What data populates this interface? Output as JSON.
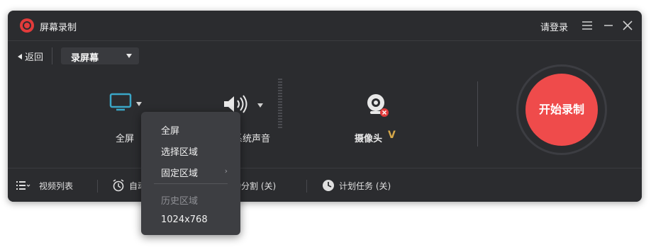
{
  "app": {
    "title": "屏幕录制",
    "login_label": "请登录"
  },
  "toolbar": {
    "back_label": "返回",
    "mode_label": "录屏幕"
  },
  "sources": {
    "screen_label": "全屏",
    "audio_label": "系统声音",
    "camera_label": "摄像头",
    "vip_badge": "V"
  },
  "record_button": {
    "label": "开始录制"
  },
  "bottom": {
    "video_list": "视频列表",
    "auto_stop": "自动停止 (关)",
    "auto_split": "自动分割 (关)",
    "schedule": "计划任务 (关)"
  },
  "dropdown_menu": {
    "items": [
      "全屏",
      "选择区域",
      "固定区域"
    ],
    "chevron": "›",
    "history_header": "历史区域",
    "history_items": [
      "1024x768"
    ]
  },
  "colors": {
    "accent_red": "#ef4b4b",
    "screen_icon": "#3aa6c7",
    "vip_gold": "#d6a84a",
    "window_bg": "#2b2c2f"
  },
  "icons": [
    "record-logo-icon",
    "menu-icon",
    "minimize-icon",
    "close-icon",
    "back-arrow-icon",
    "monitor-icon",
    "speaker-icon",
    "webcam-icon",
    "list-icon",
    "alarm-clock-icon",
    "scissors-icon",
    "clock-icon"
  ]
}
